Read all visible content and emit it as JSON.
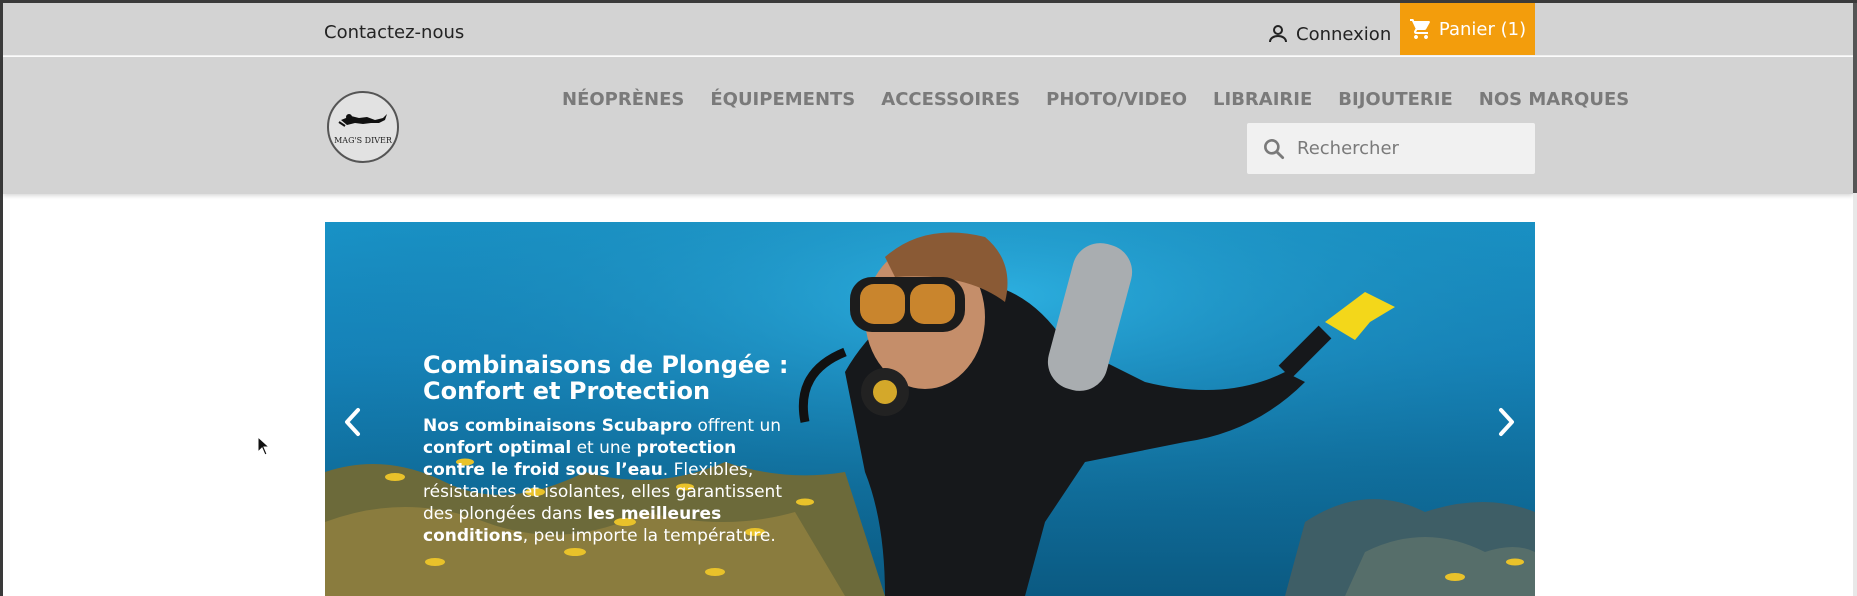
{
  "topbar": {
    "contact_label": "Contactez-nous",
    "login_label": "Connexion",
    "cart_label": "Panier (1)"
  },
  "header": {
    "logo_text": "MAG'S DIVER",
    "menu": [
      {
        "label": "NÉOPRÈNES"
      },
      {
        "label": "ÉQUIPEMENTS"
      },
      {
        "label": "ACCESSOIRES"
      },
      {
        "label": "PHOTO/VIDEO"
      },
      {
        "label": "LIBRAIRIE"
      },
      {
        "label": "BIJOUTERIE"
      },
      {
        "label": "NOS MARQUES"
      }
    ],
    "search": {
      "placeholder": "Rechercher",
      "value": ""
    }
  },
  "carousel": {
    "slide": {
      "title": "Combinaisons de Plongée : Confort et Protection",
      "text_parts": [
        {
          "text": "Nos combinaisons Scubapro",
          "bold": true
        },
        {
          "text": " offrent un ",
          "bold": false
        },
        {
          "text": "confort optimal",
          "bold": true
        },
        {
          "text": " et une ",
          "bold": false
        },
        {
          "text": "protection contre le froid sous l’eau",
          "bold": true
        },
        {
          "text": ". Flexibles, résistantes et isolantes, elles garantissent des plongées dans ",
          "bold": false
        },
        {
          "text": "les meilleures conditions",
          "bold": true
        },
        {
          "text": ", peu importe la température.",
          "bold": false
        }
      ]
    },
    "prev_icon": "chevron-left-icon",
    "next_icon": "chevron-right-icon"
  },
  "colors": {
    "accent": "#f39d0c",
    "header_bg": "#d3d3d3",
    "menu_text": "#7a7a7a"
  }
}
